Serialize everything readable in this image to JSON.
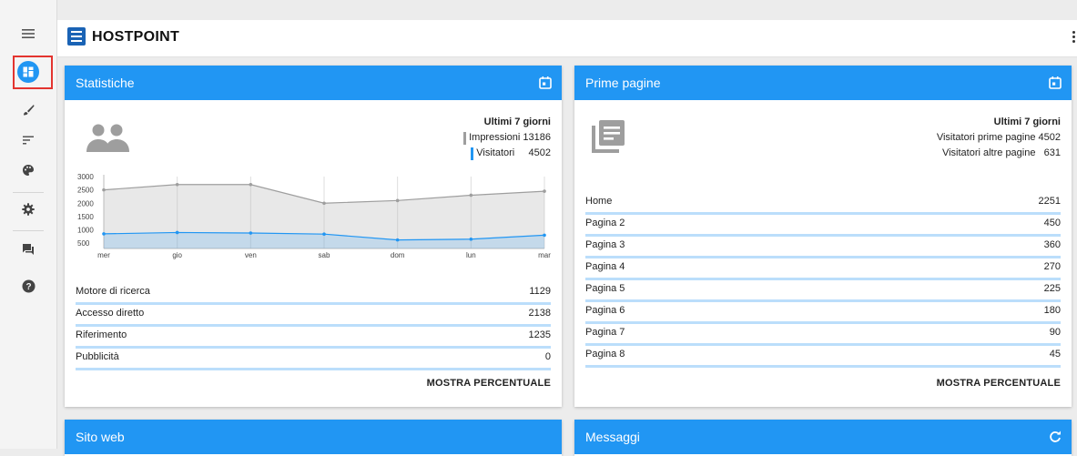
{
  "app": {
    "brand": "HOSTPOINT"
  },
  "nav": [
    {
      "icon": "menu-icon"
    },
    {
      "icon": "dashboard-icon",
      "active": true
    },
    {
      "icon": "brush-icon"
    },
    {
      "icon": "sort-icon"
    },
    {
      "icon": "palette-icon"
    },
    {
      "icon": "gear-icon"
    },
    {
      "icon": "chat-icon"
    },
    {
      "icon": "help-icon"
    }
  ],
  "colors": {
    "accent": "#2196f3",
    "active_outline": "#e3342f",
    "impressions": "#9e9e9e",
    "visitors": "#2196f3"
  },
  "statistiche": {
    "title": "Statistiche",
    "summary_title": "Ultimi 7 giorni",
    "legend": [
      {
        "label": "Impressioni",
        "value": "13186"
      },
      {
        "label": "Visitatori",
        "value": "4502"
      }
    ],
    "rows": [
      {
        "label": "Motore di ricerca",
        "value": "1129"
      },
      {
        "label": "Accesso diretto",
        "value": "2138"
      },
      {
        "label": "Riferimento",
        "value": "1235"
      },
      {
        "label": "Pubblicità",
        "value": "0"
      }
    ],
    "button": "MOSTRA PERCENTUALE"
  },
  "chart_data": {
    "type": "area",
    "categories": [
      "mer",
      "gio",
      "ven",
      "sab",
      "dom",
      "lun",
      "mar"
    ],
    "series": [
      {
        "name": "Impressioni",
        "values": [
          2500,
          2700,
          2700,
          2000,
          2100,
          2300,
          2450
        ]
      },
      {
        "name": "Visitatori",
        "values": [
          850,
          900,
          880,
          840,
          620,
          650,
          800
        ]
      }
    ],
    "y_ticks": [
      3000,
      2500,
      2000,
      1500,
      1000,
      500
    ],
    "ylim": [
      300,
      3000
    ],
    "grid": "vertical"
  },
  "prime_pagine": {
    "title": "Prime pagine",
    "summary_title": "Ultimi 7 giorni",
    "summary_lines": [
      "Visitatori prime pagine 4502",
      "Visitatori altre pagine   631"
    ],
    "rows": [
      {
        "label": "Home",
        "value": "2251"
      },
      {
        "label": "Pagina 2",
        "value": "450"
      },
      {
        "label": "Pagina 3",
        "value": "360"
      },
      {
        "label": "Pagina 4",
        "value": "270"
      },
      {
        "label": "Pagina 5",
        "value": "225"
      },
      {
        "label": "Pagina 6",
        "value": "180"
      },
      {
        "label": "Pagina 7",
        "value": "90"
      },
      {
        "label": "Pagina 8",
        "value": "45"
      }
    ],
    "button": "MOSTRA PERCENTUALE"
  },
  "sito_web": {
    "title": "Sito web"
  },
  "messaggi": {
    "title": "Messaggi"
  }
}
